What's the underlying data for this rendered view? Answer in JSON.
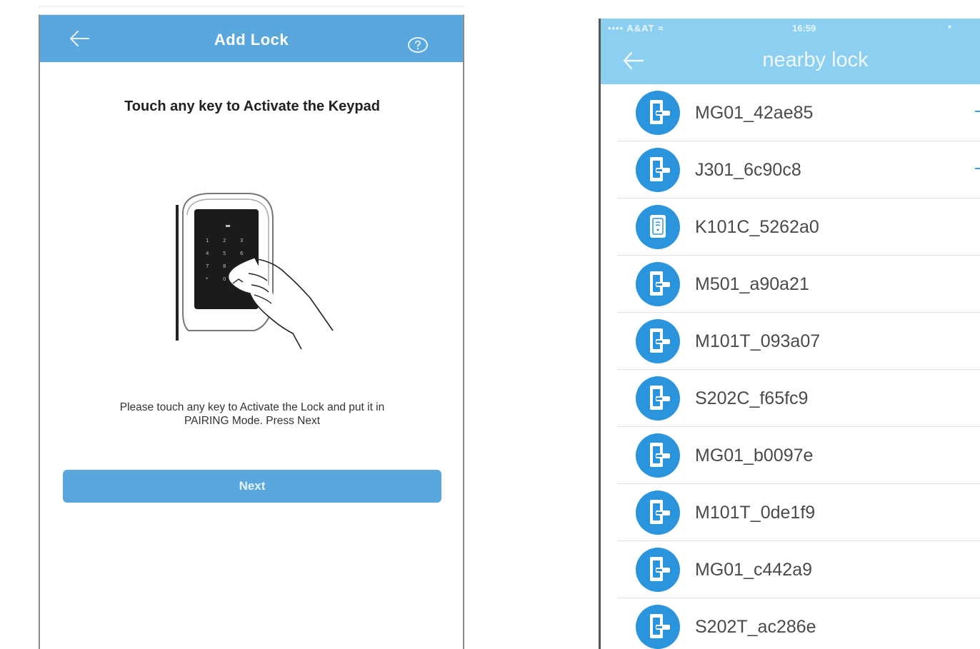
{
  "add_lock_screen": {
    "title": "Add Lock",
    "instruction_title": "Touch any key to Activate the Keypad",
    "instruction_body": "Please touch any key to Activate the Lock and put it in PAIRING Mode. Press Next",
    "next_label": "Next",
    "colors": {
      "header": "#5aa7de",
      "button": "#5aa7de"
    },
    "icons": {
      "back": "arrow-left-icon",
      "help": "question-circle-icon",
      "illustration": "keypad-touch-illustration"
    }
  },
  "nearby_lock_screen": {
    "status_bar": {
      "carrier": "••••  A&AT  ≈",
      "time": "16:59",
      "battery": "*"
    },
    "title": "nearby lock",
    "colors": {
      "header": "#8ccff1",
      "icon": "#2a95dc"
    },
    "icons": {
      "back": "arrow-left-icon",
      "door_lock": "door-lock-icon",
      "keypad_lock": "keypad-lock-icon"
    },
    "locks": [
      {
        "name": "MG01_42ae85",
        "icon": "door-lock-icon",
        "edge_mark": true
      },
      {
        "name": "J301_6c90c8",
        "icon": "door-lock-icon",
        "edge_mark": true
      },
      {
        "name": "K101C_5262a0",
        "icon": "keypad-lock-icon",
        "edge_mark": false
      },
      {
        "name": "M501_a90a21",
        "icon": "door-lock-icon",
        "edge_mark": false
      },
      {
        "name": "M101T_093a07",
        "icon": "door-lock-icon",
        "edge_mark": false
      },
      {
        "name": "S202C_f65fc9",
        "icon": "door-lock-icon",
        "edge_mark": false
      },
      {
        "name": "MG01_b0097e",
        "icon": "door-lock-icon",
        "edge_mark": false
      },
      {
        "name": "M101T_0de1f9",
        "icon": "door-lock-icon",
        "edge_mark": false
      },
      {
        "name": "MG01_c442a9",
        "icon": "door-lock-icon",
        "edge_mark": false
      },
      {
        "name": "S202T_ac286e",
        "icon": "door-lock-icon",
        "edge_mark": false
      }
    ]
  }
}
